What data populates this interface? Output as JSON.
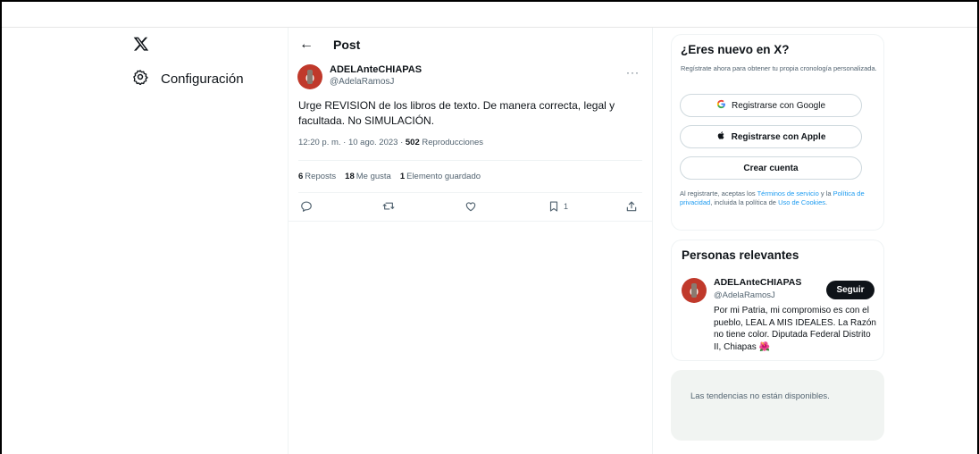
{
  "nav": {
    "logo_icon": "x-logo-icon",
    "settings_icon": "gear-icon",
    "settings_label": "Configuración"
  },
  "post": {
    "header_title": "Post",
    "author_name": "ADELAnteCHIAPAS",
    "author_handle": "@AdelaRamosJ",
    "text": "Urge REVISION de los libros de texto. De manera correcta, legal y facultada. No SIMULACIÓN.",
    "timestamp": "12:20 p. m. · 10 ago. 2023 · ",
    "views_count": "502",
    "views_label": " Reproducciones",
    "reposts_count": "6",
    "reposts_label": "Reposts",
    "likes_count": "18",
    "likes_label": "Me gusta",
    "bookmarks_count": "1",
    "bookmarks_label": "Elemento guardado",
    "bookmark_action_count": "1"
  },
  "signup": {
    "title": "¿Eres nuevo en X?",
    "subtitle": "Regístrate ahora para obtener tu propia cronología personalizada.",
    "google_label": "Registrarse con Google",
    "apple_label": "Registrarse con Apple",
    "create_label": "Crear cuenta",
    "legal_prefix": "Al registrarte, aceptas los ",
    "terms_link": "Términos de servicio",
    "legal_mid": " y la ",
    "privacy_link": "Política de privacidad",
    "legal_mid2": ", incluida la política de ",
    "cookies_link": "Uso de Cookies",
    "legal_end": "."
  },
  "relevant": {
    "title": "Personas relevantes",
    "name": "ADELAnteCHIAPAS",
    "handle": "@AdelaRamosJ",
    "follow_label": "Seguir",
    "bio": "Por mi Patria, mi compromiso es con el pueblo, LEAL A MIS IDEALES. La Razón no tiene color. Diputada Federal Distrito II, Chiapas 🌺"
  },
  "trends": {
    "message": "Las tendencias no están disponibles."
  },
  "colors": {
    "link": "#1d9bf0",
    "muted": "#536471",
    "text": "#0f1419"
  }
}
